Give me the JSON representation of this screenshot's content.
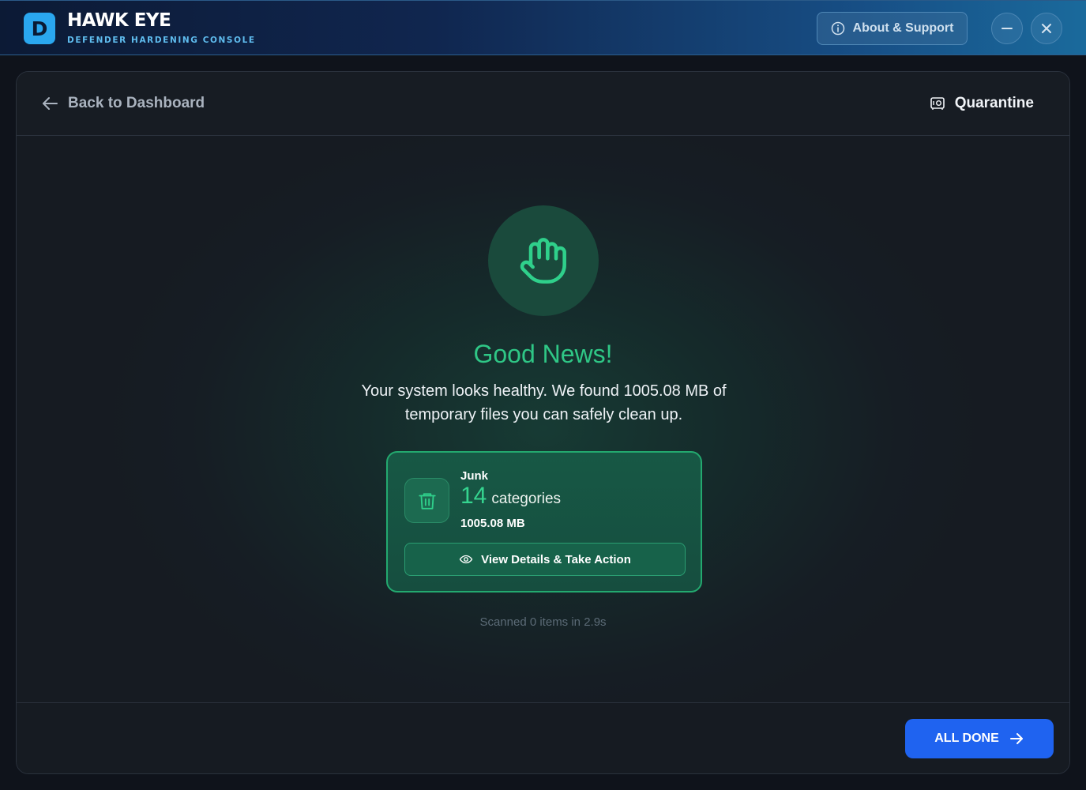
{
  "app": {
    "logo_letter": "D",
    "title": "HAWK EYE",
    "subtitle": "DEFENDER HARDENING CONSOLE"
  },
  "titlebar": {
    "about_label": "About & Support",
    "icons": [
      "info-icon",
      "minimize-icon",
      "close-icon"
    ]
  },
  "nav": {
    "back_label": "Back to Dashboard",
    "quarantine_label": "Quarantine"
  },
  "result": {
    "headline": "Good News!",
    "message": "Your system looks healthy. We found 1005.08 MB of temporary files you can safely clean up.",
    "hero_icon": "hand-icon"
  },
  "junk": {
    "label": "Junk",
    "count": "14",
    "count_unit": "categories",
    "size": "1005.08 MB",
    "action_label": "View Details & Take Action",
    "icon": "trash-icon"
  },
  "scan_note": "Scanned 0 items in 2.9s",
  "footer": {
    "done_label": "ALL DONE"
  },
  "colors": {
    "accent_green": "#2fc786",
    "primary_blue": "#1f63f0",
    "logo_blue": "#2aa7ef"
  }
}
